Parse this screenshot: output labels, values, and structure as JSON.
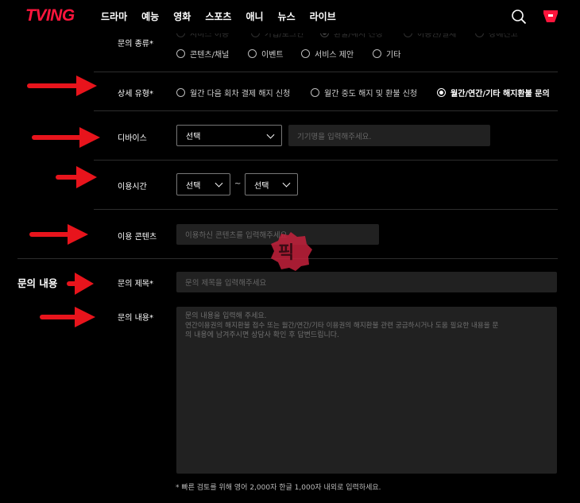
{
  "header": {
    "logo": "TVING",
    "nav": [
      "드라마",
      "예능",
      "영화",
      "스포츠",
      "애니",
      "뉴스",
      "라이브"
    ]
  },
  "form": {
    "inquiry_type": {
      "label": "문의 종류*",
      "top_row": [
        {
          "text": "서비스 이용",
          "selected": false
        },
        {
          "text": "가입/로그인",
          "selected": false
        },
        {
          "text": "환불/해지 신청",
          "selected": true
        },
        {
          "text": "이용권/결제",
          "selected": false
        },
        {
          "text": "장애신고",
          "selected": false
        }
      ],
      "options": [
        {
          "text": "콘텐츠/채널",
          "selected": false
        },
        {
          "text": "이벤트",
          "selected": false
        },
        {
          "text": "서비스 제안",
          "selected": false
        },
        {
          "text": "기타",
          "selected": false
        }
      ]
    },
    "detail_type": {
      "label": "상세 유형*",
      "options": [
        {
          "text": "월간 다음 회차 결제 해지 신청",
          "selected": false
        },
        {
          "text": "월간 중도 해지 및 환불 신청",
          "selected": false
        },
        {
          "text": "월간/연간/기타 해지환불 문의",
          "selected": true
        }
      ]
    },
    "device": {
      "label": "디바이스",
      "select_value": "선택",
      "input_placeholder": "기기명을 입력해주세요."
    },
    "usage_time": {
      "label": "이용시간",
      "from": "선택",
      "separator": "~",
      "to": "선택"
    },
    "content": {
      "label": "이용 콘텐츠",
      "placeholder": "이용하신 콘텐츠를 입력해주세요"
    },
    "title": {
      "label": "문의 제목*",
      "placeholder": "문의 제목을 입력해주세요"
    },
    "body": {
      "label": "문의 내용*",
      "placeholder_line1": "문의 내용을 입력해 주세요.",
      "placeholder_line2": "연간이용권의 해지환불 접수 또는 월간/연간/기타 이용권의 해지환불 관련 궁금하시거나 도움 필요한 내용을 문",
      "placeholder_line3": "의 내용에 남겨주시면 상담사 확인 후 답변드립니다."
    },
    "note": "* 빠른 검토를 위해 영어 2,000자 한글 1,000자 내외로 입력하세요."
  },
  "annotation": {
    "side_label": "문의 내용",
    "watermark": "픽",
    "arrow_color": "#e8141c"
  },
  "colors": {
    "brand": "#ff153c",
    "background": "#000000",
    "field_bg": "#212121"
  }
}
